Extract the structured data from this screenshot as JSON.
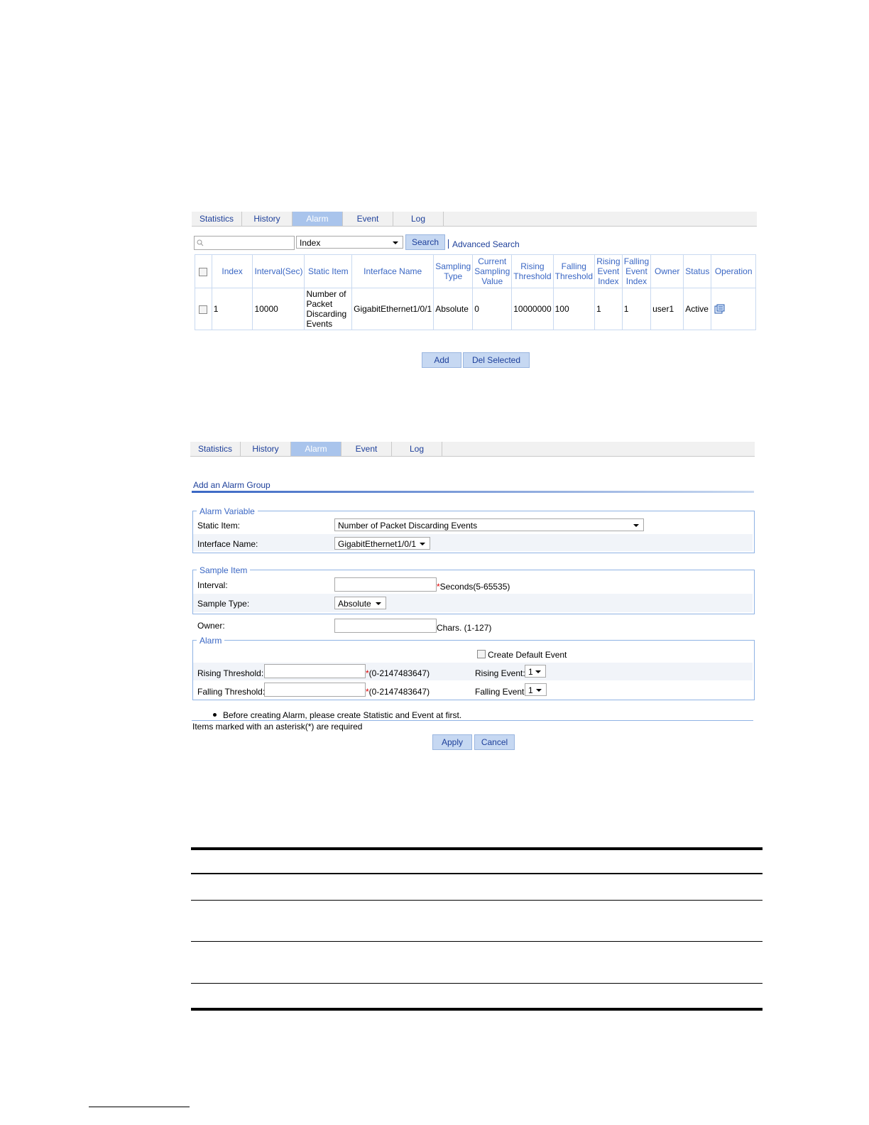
{
  "list_view": {
    "tabs": [
      "Statistics",
      "History",
      "Alarm",
      "Event",
      "Log"
    ],
    "active_tab": "Alarm",
    "search": {
      "value": "",
      "field": "Index",
      "search_label": "Search",
      "advanced_label": "Advanced Search"
    },
    "table": {
      "headers": {
        "index": "Index",
        "interval": "Interval(Sec)",
        "static_item": "Static Item",
        "interface_name": "Interface Name",
        "sampling_type": "Sampling Type",
        "current_sampling_value": "Current Sampling Value",
        "rising_threshold": "Rising Threshold",
        "falling_threshold": "Falling Threshold",
        "rising_event_index": "Rising Event Index",
        "falling_event_index": "Falling Event Index",
        "owner": "Owner",
        "status": "Status",
        "operation": "Operation"
      },
      "rows": [
        {
          "index": "1",
          "interval": "10000",
          "static_item": "Number of Packet Discarding Events",
          "interface_name": "GigabitEthernet1/0/1",
          "sampling_type": "Absolute",
          "current_sampling_value": "0",
          "rising_threshold": "10000000",
          "falling_threshold": "100",
          "rising_event_index": "1",
          "falling_event_index": "1",
          "owner": "user1",
          "status": "Active"
        }
      ]
    },
    "buttons": {
      "add": "Add",
      "del_selected": "Del Selected"
    }
  },
  "add_view": {
    "tabs": [
      "Statistics",
      "History",
      "Alarm",
      "Event",
      "Log"
    ],
    "active_tab": "Alarm",
    "title": "Add an Alarm Group",
    "alarm_variable": {
      "legend": "Alarm Variable",
      "static_item_label": "Static Item:",
      "static_item_value": "Number of Packet Discarding Events",
      "interface_label": "Interface Name:",
      "interface_value": "GigabitEthernet1/0/1"
    },
    "sample_item": {
      "legend": "Sample Item",
      "interval_label": "Interval:",
      "interval_value": "",
      "interval_hint": "Seconds(5-65535)",
      "sample_type_label": "Sample Type:",
      "sample_type_value": "Absolute"
    },
    "owner": {
      "label": "Owner:",
      "value": "",
      "hint": "Chars. (1-127)"
    },
    "alarm": {
      "legend": "Alarm",
      "create_default_event_label": "Create Default Event",
      "rising_threshold_label": "Rising Threshold:",
      "rising_threshold_value": "",
      "rising_threshold_hint": "(0-2147483647)",
      "falling_threshold_label": "Falling Threshold:",
      "falling_threshold_value": "",
      "falling_threshold_hint": "(0-2147483647)",
      "rising_event_label": "Rising Event:",
      "rising_event_value": "1",
      "falling_event_label": "Falling Event:",
      "falling_event_value": "1"
    },
    "note": "Before creating Alarm, please create Statistic and Event at first.",
    "required_note": "Items marked with an asterisk(*) are required",
    "buttons": {
      "apply": "Apply",
      "cancel": "Cancel"
    }
  }
}
